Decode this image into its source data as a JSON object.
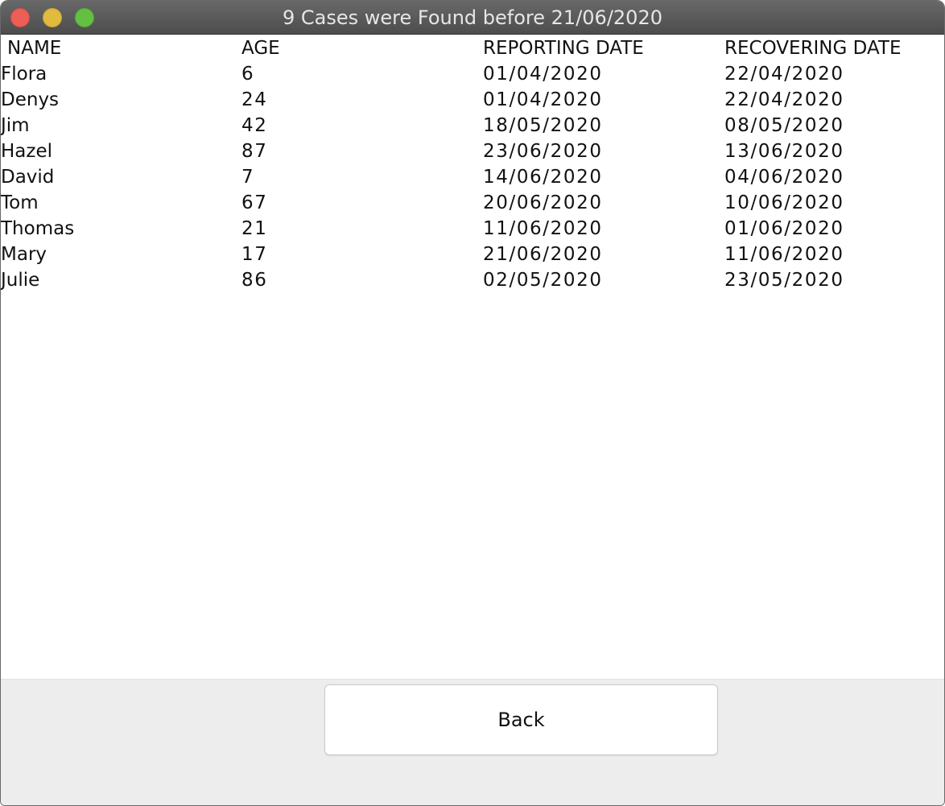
{
  "window": {
    "title": "9 Cases were Found before 21/06/2020"
  },
  "table": {
    "headers": [
      "NAME",
      "AGE",
      "REPORTING DATE",
      "RECOVERING DATE"
    ],
    "rows": [
      [
        "Flora",
        "6",
        "01/04/2020",
        "22/04/2020"
      ],
      [
        "Denys",
        "24",
        "01/04/2020",
        "22/04/2020"
      ],
      [
        "Jim",
        "42",
        "18/05/2020",
        "08/05/2020"
      ],
      [
        "Hazel",
        "87",
        "23/06/2020",
        "13/06/2020"
      ],
      [
        "David",
        "7",
        "14/06/2020",
        "04/06/2020"
      ],
      [
        "Tom",
        "67",
        "20/06/2020",
        "10/06/2020"
      ],
      [
        "Thomas",
        "21",
        "11/06/2020",
        "01/06/2020"
      ],
      [
        "Mary",
        "17",
        "21/06/2020",
        "11/06/2020"
      ],
      [
        "Julie",
        "86",
        "02/05/2020",
        "23/05/2020"
      ]
    ]
  },
  "footer": {
    "back_label": "Back"
  },
  "colors": {
    "close": "#ec5f57",
    "minimize": "#e0bb3e",
    "maximize": "#64c043"
  }
}
